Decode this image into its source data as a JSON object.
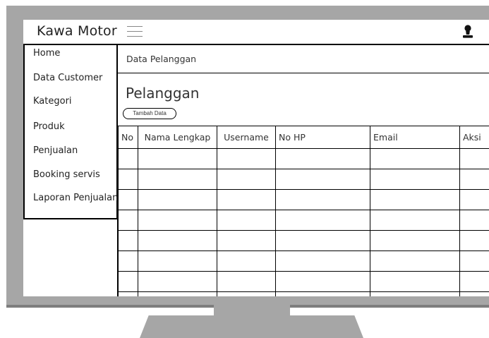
{
  "app": {
    "title": "Kawa Motor"
  },
  "icons": {
    "menu": "hamburger-icon",
    "user": "user-icon"
  },
  "sidebar": {
    "items": [
      {
        "label": "Home"
      },
      {
        "label": "Data Customer"
      },
      {
        "label": "Kategori"
      },
      {
        "label": "Produk"
      },
      {
        "label": "Penjualan"
      },
      {
        "label": "Booking servis"
      },
      {
        "label": "Laporan Penjualan"
      }
    ]
  },
  "main": {
    "breadcrumb": "Data Pelanggan",
    "title": "Pelanggan",
    "add_button": "Tambah Data"
  },
  "table": {
    "columns": [
      "No",
      "Nama Lengkap",
      "Username",
      "No HP",
      "Email",
      "Aksi"
    ],
    "rows": [
      [
        "",
        "",
        "",
        "",
        "",
        ""
      ],
      [
        "",
        "",
        "",
        "",
        "",
        ""
      ],
      [
        "",
        "",
        "",
        "",
        "",
        ""
      ],
      [
        "",
        "",
        "",
        "",
        "",
        ""
      ],
      [
        "",
        "",
        "",
        "",
        "",
        ""
      ],
      [
        "",
        "",
        "",
        "",
        "",
        ""
      ],
      [
        "",
        "",
        "",
        "",
        "",
        ""
      ],
      [
        "",
        "",
        "",
        "",
        "",
        ""
      ]
    ]
  },
  "colors": {
    "frame": "#a6a6a6",
    "border": "#000000",
    "text": "#333333"
  }
}
